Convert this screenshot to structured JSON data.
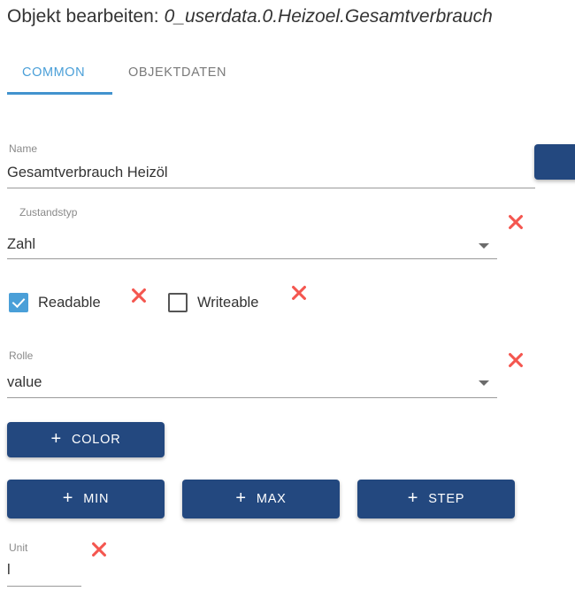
{
  "header": {
    "title_static": "Objekt bearbeiten:",
    "object_id": "0_userdata.0.Heizoel.Gesamtverbrauch"
  },
  "tabs": {
    "active": "COMMON",
    "items": [
      {
        "label": "COMMON",
        "active": true
      },
      {
        "label": "OBJEKTDATEN",
        "active": false
      }
    ]
  },
  "colors": {
    "accent_blue": "#4a9fd8",
    "tab_indicator": "#4293ce",
    "button_blue": "#23487f",
    "clear_red": "#f4564f",
    "label_grey": "#8a8a8a",
    "underline_grey": "#9a9a9a"
  },
  "form": {
    "name": {
      "label": "Name",
      "value": "Gesamtverbrauch Heizöl",
      "placeholder": "Name"
    },
    "zustandstyp": {
      "label": "Zustandstyp",
      "value": "Zahl",
      "clear_icon": "close-x-icon",
      "dropdown_icon": "chevron-down-icon"
    },
    "readable": {
      "label": "Readable",
      "checked": true,
      "clear_icon": "close-x-icon"
    },
    "writeable": {
      "label": "Writeable",
      "checked": false,
      "clear_icon": "close-x-icon"
    },
    "rolle": {
      "label": "Rolle",
      "value": "value",
      "clear_icon": "close-x-icon",
      "dropdown_icon": "chevron-down-icon"
    },
    "unit": {
      "label": "Unit",
      "value": "l",
      "clear_icon": "close-x-icon"
    }
  },
  "buttons": {
    "plus_glyph": "+",
    "color": "COLOR",
    "min": "MIN",
    "max": "MAX",
    "step": "STEP"
  }
}
